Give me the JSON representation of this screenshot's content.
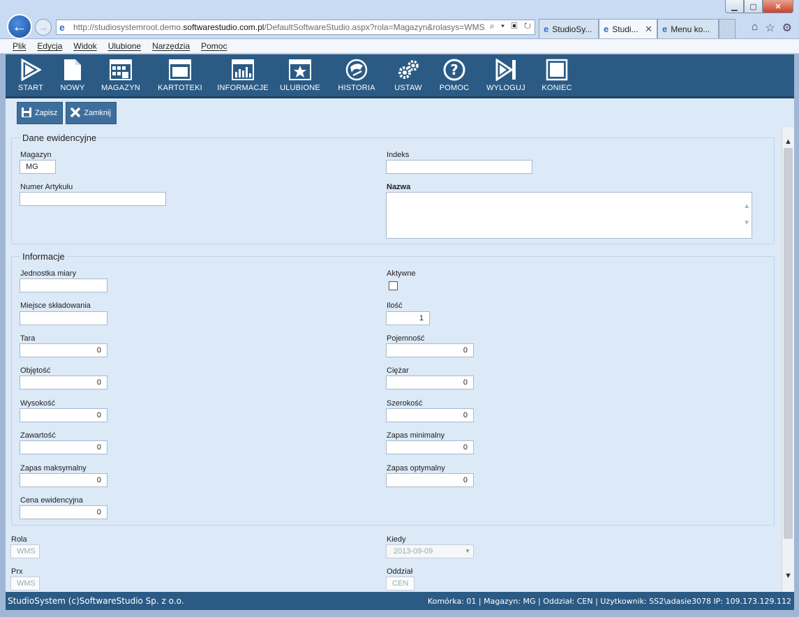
{
  "browser": {
    "url_prefix": "http://studiosystemroot.demo.",
    "url_domain": "softwarestudio.com.pl",
    "url_path": "/DefaultSoftwareStudio.aspx?rola=Magazyn&rolasys=WMS",
    "addr_tools": "⌕ ▾ ▣ ↻",
    "tabs": [
      {
        "label": "StudioSy..."
      },
      {
        "label": "Studi...",
        "close": "✕"
      },
      {
        "label": "Menu ko..."
      }
    ],
    "win_min": "▁",
    "win_max": "▢",
    "win_close": "✕"
  },
  "menu": [
    "Plik",
    "Edycja",
    "Widok",
    "Ulubione",
    "Narzędzia",
    "Pomoc"
  ],
  "toolbar": [
    {
      "label": "START",
      "icon": "play-icon"
    },
    {
      "label": "NOWY",
      "icon": "new-document-icon"
    },
    {
      "label": "MAGAZYN",
      "icon": "warehouse-grid-icon"
    },
    {
      "label": "KARTOTEKI",
      "icon": "window-icon"
    },
    {
      "label": "INFORMACJE",
      "icon": "chart-icon"
    },
    {
      "label": "ULUBIONE",
      "icon": "star-icon"
    },
    {
      "label": "HISTORIA",
      "icon": "history-icon"
    },
    {
      "label": "USTAW",
      "icon": "gears-icon"
    },
    {
      "label": "POMOC",
      "icon": "help-icon"
    },
    {
      "label": "WYLOGUJ",
      "icon": "logout-icon"
    },
    {
      "label": "KONIEC",
      "icon": "stop-icon"
    }
  ],
  "actions": {
    "save": "Zapisz",
    "close": "Zamknij"
  },
  "dane": {
    "legend": "Dane ewidencyjne",
    "magazyn_label": "Magazyn",
    "magazyn_value": "MG",
    "indeks_label": "Indeks",
    "indeks_value": "",
    "numer_label": "Numer Artykułu",
    "numer_value": "",
    "nazwa_label": "Nazwa"
  },
  "info": {
    "legend": "Informacje",
    "jm_label": "Jednostka miary",
    "jm_value": "",
    "aktywne_label": "Aktywne",
    "miejsce_label": "Miejsce składowania",
    "miejsce_value": "",
    "ilosc_label": "Ilość",
    "ilosc_value": "1",
    "tara_label": "Tara",
    "tara_value": "0",
    "pojemnosc_label": "Pojemność",
    "pojemnosc_value": "0",
    "objetosc_label": "Objętość",
    "objetosc_value": "0",
    "ciezar_label": "Ciężar",
    "ciezar_value": "0",
    "wysokosc_label": "Wysokość",
    "wysokosc_value": "0",
    "szerokosc_label": "Szerokość",
    "szerokosc_value": "0",
    "zawartosc_label": "Zawartość",
    "zawartosc_value": "0",
    "zapas_min_label": "Zapas minimalny",
    "zapas_min_value": "0",
    "zapas_max_label": "Zapas maksymalny",
    "zapas_max_value": "0",
    "zapas_opt_label": "Zapas optymalny",
    "zapas_opt_value": "0",
    "cena_label": "Cena ewidencyjna",
    "cena_value": "0"
  },
  "meta": {
    "rola_label": "Rola",
    "rola_value": "WMS",
    "kiedy_label": "Kiedy",
    "kiedy_value": "2013-09-09",
    "prx_label": "Prx",
    "prx_value": "WMS",
    "oddzial_label": "Oddział",
    "oddzial_value": "CEN"
  },
  "status": {
    "left": "StudioSystem (c)SoftwareStudio Sp. z o.o.",
    "right": "Komórka: 01 | Magazyn: MG | Oddział: CEN | Użytkownik: SS2\\adasie3078 IP: 109.173.129.112"
  }
}
